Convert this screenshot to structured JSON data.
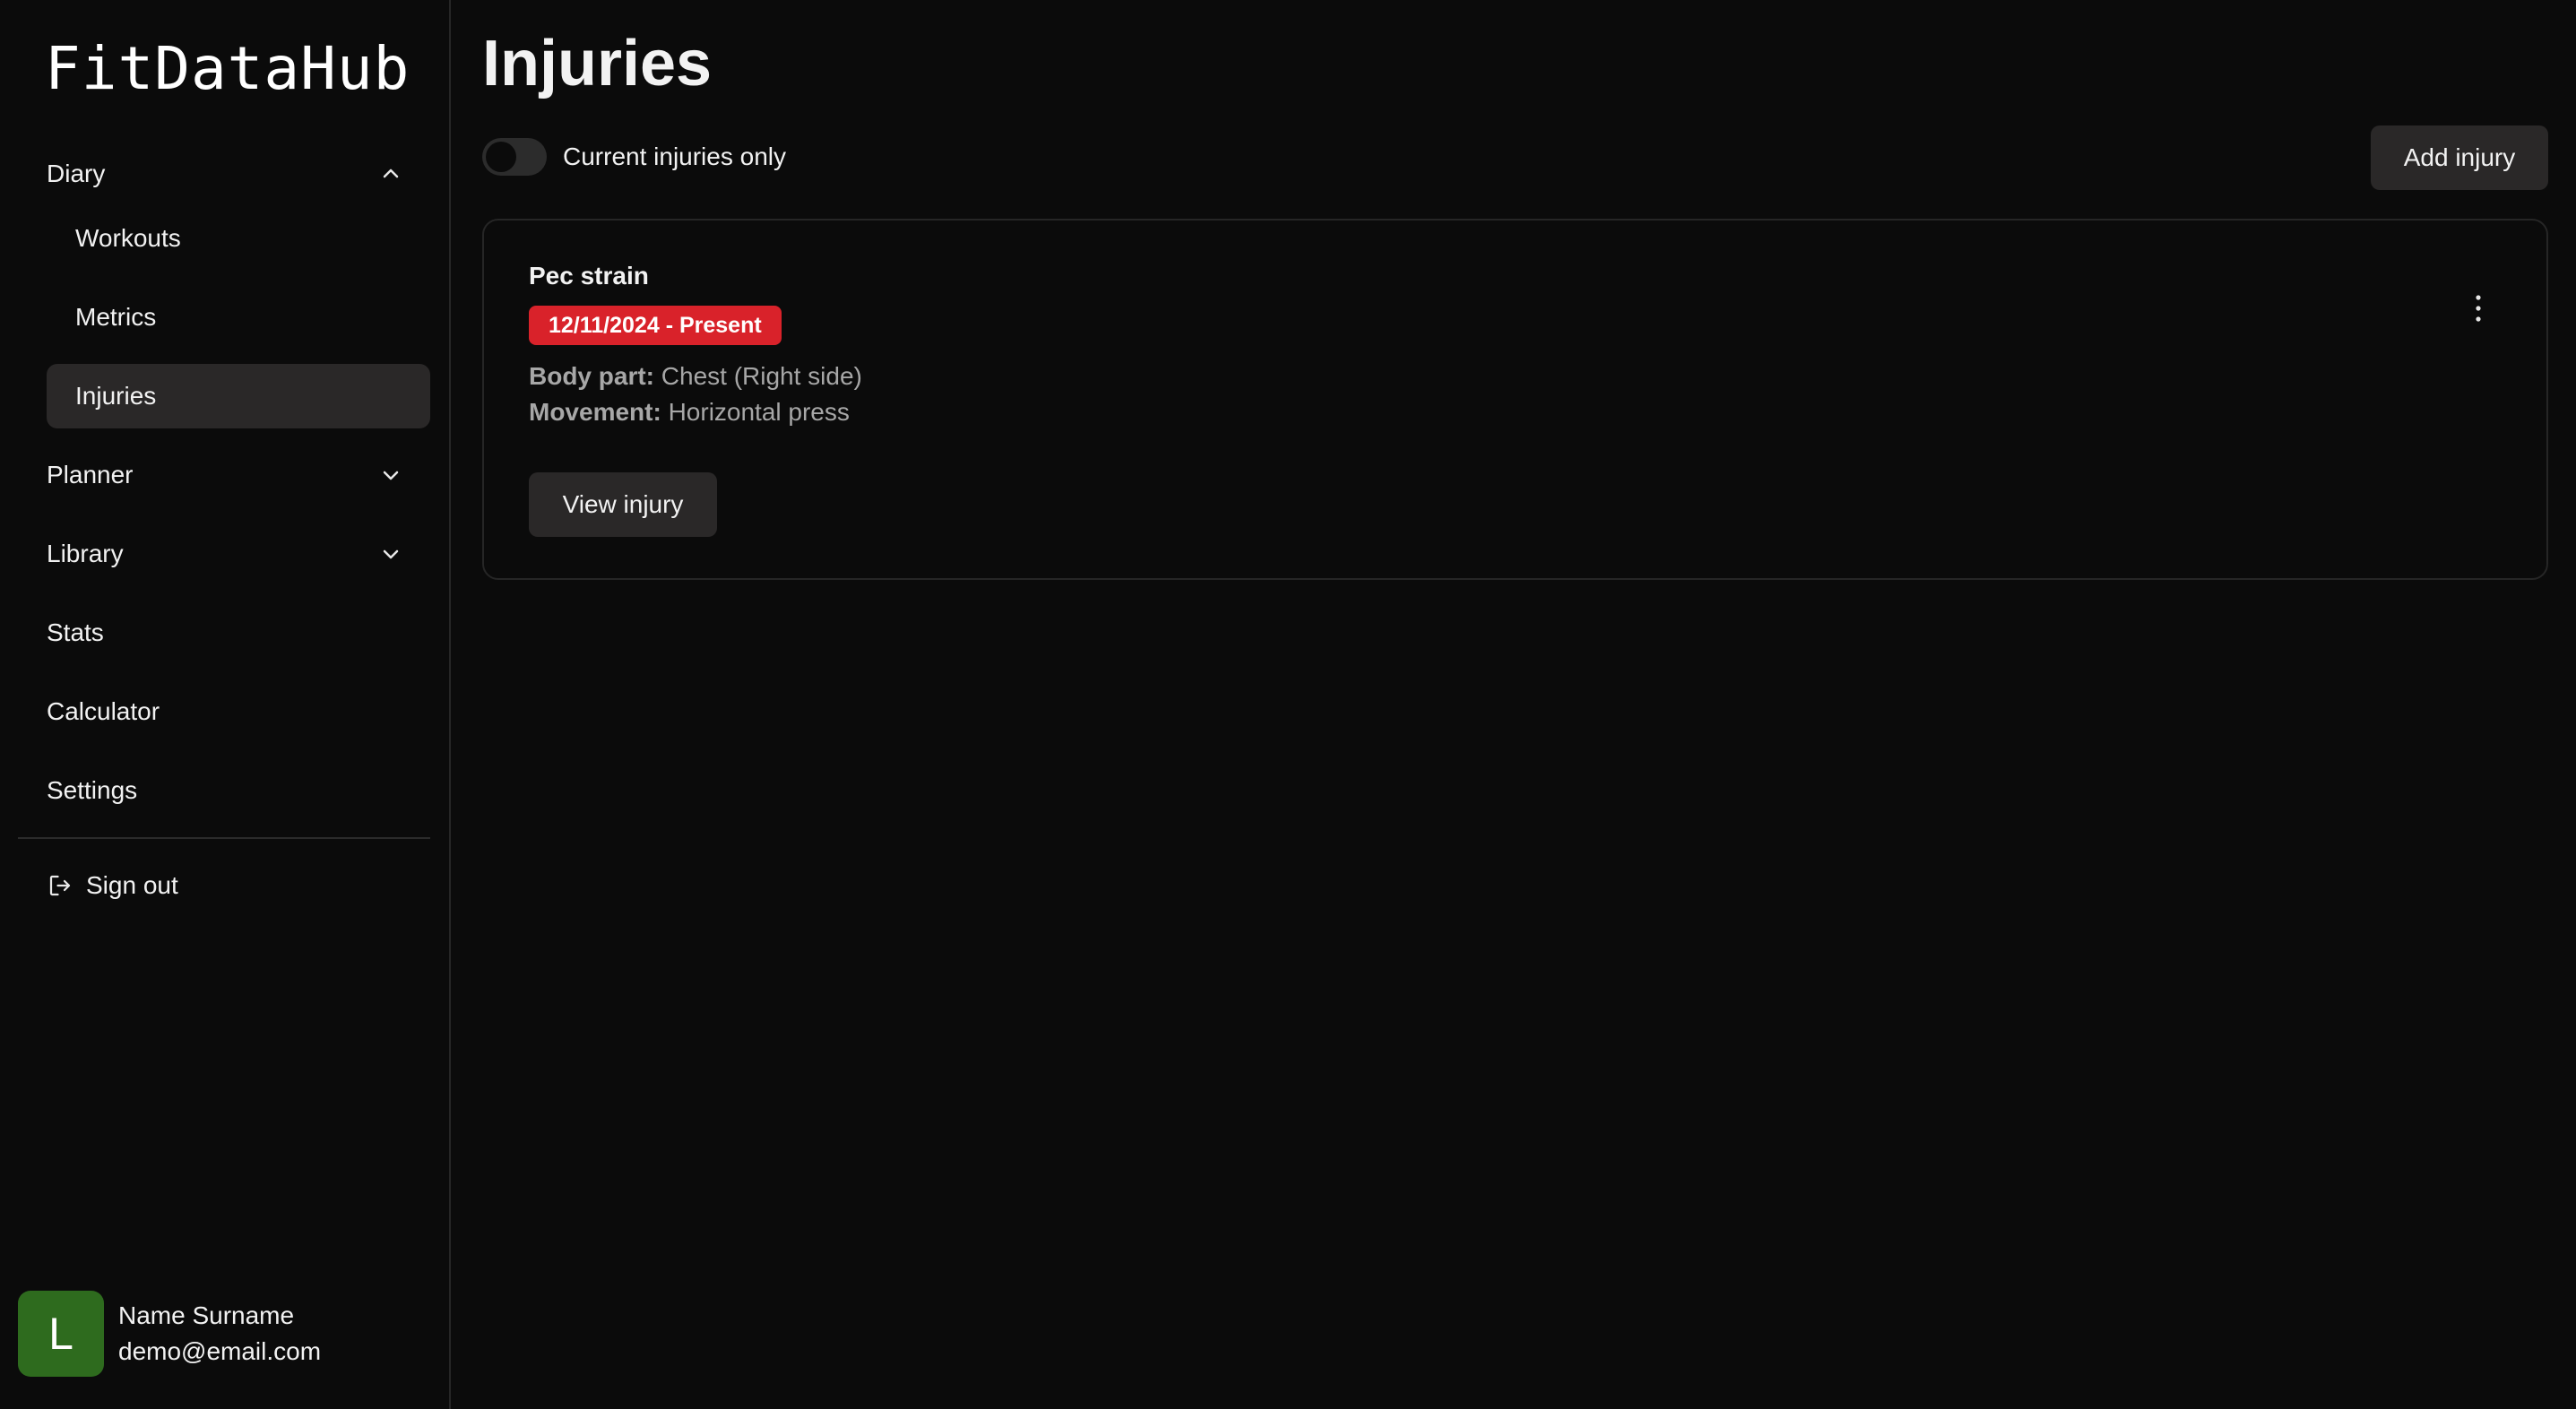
{
  "app": {
    "name": "FitDataHub"
  },
  "sidebar": {
    "diary": {
      "label": "Diary",
      "items": [
        {
          "label": "Workouts"
        },
        {
          "label": "Metrics"
        },
        {
          "label": "Injuries",
          "active": true
        }
      ]
    },
    "planner": {
      "label": "Planner"
    },
    "library": {
      "label": "Library"
    },
    "stats": {
      "label": "Stats"
    },
    "calculator": {
      "label": "Calculator"
    },
    "settings": {
      "label": "Settings"
    },
    "signout": {
      "label": "Sign out",
      "icon": "sign-out-icon"
    },
    "user": {
      "initial": "L",
      "name": "Name Surname",
      "email": "demo@email.com",
      "avatar_color": "#2e6b1e"
    }
  },
  "main": {
    "title": "Injuries",
    "filter": {
      "label": "Current injuries only",
      "checked": false
    },
    "add_button": "Add injury",
    "injuries": [
      {
        "name": "Pec strain",
        "date_range": "12/11/2024 - Present",
        "body_part_label": "Body part:",
        "body_part": "Chest (Right side)",
        "movement_label": "Movement:",
        "movement": "Horizontal press",
        "view_button": "View injury",
        "badge_color": "#d9222a"
      }
    ]
  }
}
